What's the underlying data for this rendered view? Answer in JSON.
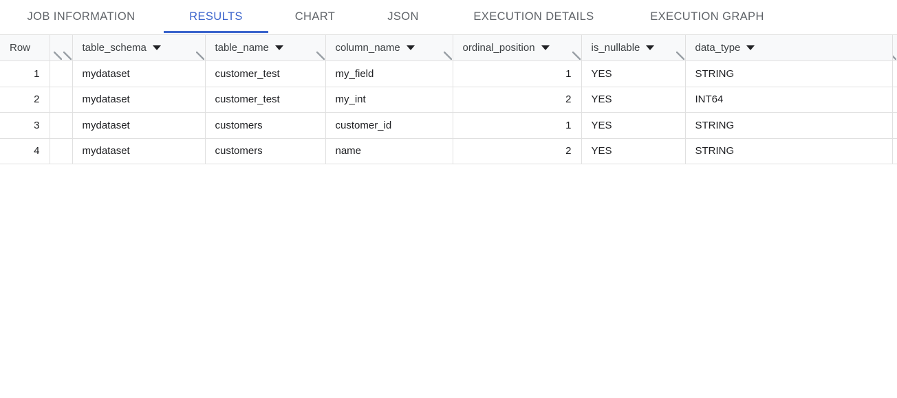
{
  "tabs": [
    {
      "id": "job-information",
      "label": "JOB INFORMATION",
      "active": false
    },
    {
      "id": "results",
      "label": "RESULTS",
      "active": true
    },
    {
      "id": "chart",
      "label": "CHART",
      "active": false
    },
    {
      "id": "json",
      "label": "JSON",
      "active": false
    },
    {
      "id": "execution-details",
      "label": "EXECUTION DETAILS",
      "active": false
    },
    {
      "id": "execution-graph",
      "label": "EXECUTION GRAPH",
      "active": false
    }
  ],
  "table": {
    "row_header_label": "Row",
    "columns": [
      {
        "name": "table_schema",
        "label": "table_schema",
        "align": "left",
        "has_menu": true
      },
      {
        "name": "table_name",
        "label": "table_name",
        "align": "left",
        "has_menu": true
      },
      {
        "name": "column_name",
        "label": "column_name",
        "align": "left",
        "has_menu": true
      },
      {
        "name": "ordinal_position",
        "label": "ordinal_position",
        "align": "right",
        "has_menu": true
      },
      {
        "name": "is_nullable",
        "label": "is_nullable",
        "align": "left",
        "has_menu": true
      },
      {
        "name": "data_type",
        "label": "data_type",
        "align": "left",
        "has_menu": true
      }
    ],
    "rows": [
      {
        "row": "1",
        "table_schema": "mydataset",
        "table_name": "customer_test",
        "column_name": "my_field",
        "ordinal_position": "1",
        "is_nullable": "YES",
        "data_type": "STRING"
      },
      {
        "row": "2",
        "table_schema": "mydataset",
        "table_name": "customer_test",
        "column_name": "my_int",
        "ordinal_position": "2",
        "is_nullable": "YES",
        "data_type": "INT64"
      },
      {
        "row": "3",
        "table_schema": "mydataset",
        "table_name": "customers",
        "column_name": "customer_id",
        "ordinal_position": "1",
        "is_nullable": "YES",
        "data_type": "STRING"
      },
      {
        "row": "4",
        "table_schema": "mydataset",
        "table_name": "customers",
        "column_name": "name",
        "ordinal_position": "2",
        "is_nullable": "YES",
        "data_type": "STRING"
      }
    ]
  },
  "icons": {
    "column_menu": "chevron-down-icon",
    "column_resize": "resize-handle-icon"
  },
  "colors": {
    "accent": "#3b64cc",
    "header_bg": "#f8f9fa",
    "border": "#e0e0e0",
    "text": "#202124",
    "muted_text": "#5f6368"
  }
}
